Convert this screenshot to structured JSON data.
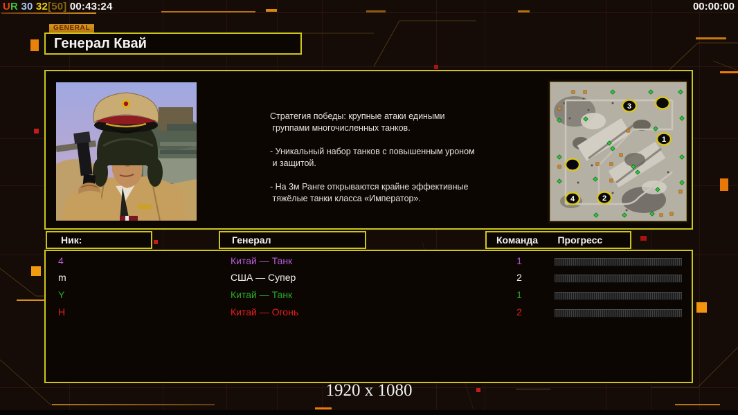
{
  "status_bar": {
    "left_segments": [
      {
        "text": "U",
        "color": "#e8430f"
      },
      {
        "text": "R",
        "color": "#3cc43c"
      },
      {
        "text": " 30",
        "color": "#a6c6f2"
      },
      {
        "text": " 32",
        "color": "#eed20e"
      },
      {
        "text": "[50]",
        "color": "#85660f"
      },
      {
        "text": " 00:43:24",
        "color": "#f4f4f4"
      }
    ],
    "right_time": "00:00:00"
  },
  "tab": {
    "label": "GENERAL"
  },
  "header": {
    "title": "Генерал Квай"
  },
  "general_info": {
    "description": "Стратегия победы: крупные атаки едиными\n группами многочисленных танков.\n\n- Уникальный набор танков с повышенным уроном\n и защитой.\n\n- На 3м Ранге открываются крайне эффективные\n тяжёлые танки класса «Император»."
  },
  "map": {
    "position_labels": {
      "p3": "3",
      "p1": "1",
      "p4": "4",
      "p2": "2"
    },
    "marker_legend": {
      "green": "supply-marker",
      "orange": "oil-marker",
      "circle": "start-position"
    }
  },
  "table": {
    "headers": {
      "nick": "Ник:",
      "general": "Генерал",
      "team": "Команда",
      "progress": "Прогресс"
    },
    "rows": [
      {
        "nick": "4",
        "general": "Китай — Танк",
        "team": "1",
        "color": "#b55cd6"
      },
      {
        "nick": "m",
        "general": "США — Супер",
        "team": "2",
        "color": "#f2f2f2"
      },
      {
        "nick": "Y",
        "general": "Китай — Танк",
        "team": "1",
        "color": "#2aa82a"
      },
      {
        "nick": "Н",
        "general": "Китай — Огонь",
        "team": "2",
        "color": "#e41d1d"
      }
    ]
  },
  "footer": {
    "resolution": "1920 x 1080"
  },
  "colors": {
    "panel_border": "#cdc51d",
    "background": "#150b07",
    "accent_orange": "#e8820c"
  }
}
